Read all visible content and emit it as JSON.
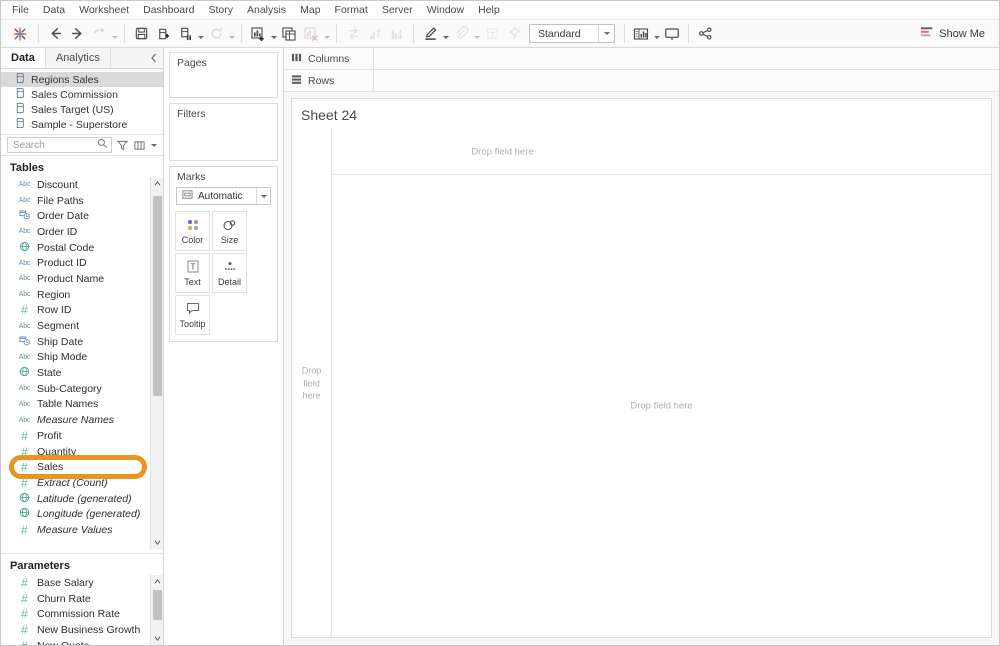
{
  "menubar": {
    "items": [
      "File",
      "Data",
      "Worksheet",
      "Dashboard",
      "Story",
      "Analysis",
      "Map",
      "Format",
      "Server",
      "Window",
      "Help"
    ]
  },
  "toolbar": {
    "logo_icon": "tableau-logo-icon",
    "buttons": [
      {
        "name": "back-button",
        "icon": "arrow-left-icon",
        "disabled": false
      },
      {
        "name": "forward-button",
        "icon": "arrow-right-icon",
        "disabled": false
      },
      {
        "name": "undo-redo-button",
        "icon": "undo-icon",
        "disabled": true
      },
      {
        "name": "save-button",
        "icon": "save-icon",
        "disabled": false
      },
      {
        "name": "new-data-source-button",
        "icon": "data-source-add-icon",
        "disabled": false
      },
      {
        "name": "pause-auto-updates-button",
        "icon": "pause-updates-icon",
        "disabled": false
      },
      {
        "name": "refresh-button",
        "icon": "refresh-icon",
        "disabled": true
      },
      {
        "name": "new-worksheet-button",
        "icon": "new-worksheet-icon",
        "disabled": false
      },
      {
        "name": "duplicate-sheet-button",
        "icon": "duplicate-sheet-icon",
        "disabled": false
      },
      {
        "name": "clear-sheet-button",
        "icon": "clear-sheet-icon",
        "disabled": true
      },
      {
        "name": "swap-rows-columns-button",
        "icon": "swap-axes-icon",
        "disabled": true
      },
      {
        "name": "sort-ascending-button",
        "icon": "sort-ascending-icon",
        "disabled": true
      },
      {
        "name": "sort-descending-button",
        "icon": "sort-descending-icon",
        "disabled": true
      },
      {
        "name": "highlight-button",
        "icon": "highlighter-icon",
        "disabled": false
      },
      {
        "name": "group-members-button",
        "icon": "paperclip-icon",
        "disabled": true
      },
      {
        "name": "show-mark-labels-button",
        "icon": "text-label-icon",
        "disabled": true
      },
      {
        "name": "fix-axes-button",
        "icon": "pin-icon",
        "disabled": true
      },
      {
        "name": "presentation-mode-button",
        "icon": "presentation-icon",
        "disabled": false
      },
      {
        "name": "share-button",
        "icon": "share-icon",
        "disabled": false
      }
    ],
    "fit": {
      "value": "Standard",
      "caret_icon": "chevron-down-icon"
    },
    "show_me": {
      "label": "Show Me",
      "icon": "show-me-icon"
    }
  },
  "data_pane": {
    "tabs": [
      {
        "label": "Data",
        "active": true
      },
      {
        "label": "Analytics",
        "active": false
      }
    ],
    "collapse_icon": "chevron-left-icon",
    "data_sources": [
      {
        "label": "Regions Sales",
        "icon": "database-icon",
        "selected": true
      },
      {
        "label": "Sales Commission",
        "icon": "database-icon",
        "selected": false
      },
      {
        "label": "Sales Target (US)",
        "icon": "database-icon",
        "selected": false
      },
      {
        "label": "Sample - Superstore",
        "icon": "database-icon",
        "selected": false
      }
    ],
    "search": {
      "placeholder": "Search",
      "search_icon": "search-icon",
      "filter_icon": "funnel-icon",
      "group_icon": "columns-icon",
      "caret_icon": "chevron-down-icon"
    },
    "tables": {
      "title": "Tables",
      "fields": [
        {
          "label": "Discount",
          "type": "abc",
          "italic": false
        },
        {
          "label": "File Paths",
          "type": "abc",
          "italic": false
        },
        {
          "label": "Order Date",
          "type": "date",
          "italic": false
        },
        {
          "label": "Order ID",
          "type": "abc",
          "italic": false
        },
        {
          "label": "Postal Code",
          "type": "geo",
          "italic": false
        },
        {
          "label": "Product ID",
          "type": "abc",
          "italic": false
        },
        {
          "label": "Product Name",
          "type": "abc",
          "italic": false
        },
        {
          "label": "Region",
          "type": "abc",
          "italic": false
        },
        {
          "label": "Row ID",
          "type": "num",
          "italic": false
        },
        {
          "label": "Segment",
          "type": "abc",
          "italic": false
        },
        {
          "label": "Ship Date",
          "type": "date",
          "italic": false
        },
        {
          "label": "Ship Mode",
          "type": "abc",
          "italic": false
        },
        {
          "label": "State",
          "type": "geo",
          "italic": false
        },
        {
          "label": "Sub-Category",
          "type": "abc",
          "italic": false
        },
        {
          "label": "Table Names",
          "type": "abc",
          "italic": false
        },
        {
          "label": "Measure Names",
          "type": "abc",
          "italic": true
        },
        {
          "label": "Profit",
          "type": "num",
          "italic": false
        },
        {
          "label": "Quantity",
          "type": "num",
          "italic": false
        },
        {
          "label": "Sales",
          "type": "num",
          "italic": false,
          "highlighted": true
        },
        {
          "label": "Extract (Count)",
          "type": "num",
          "italic": true
        },
        {
          "label": "Latitude (generated)",
          "type": "geo",
          "italic": true
        },
        {
          "label": "Longitude (generated)",
          "type": "geo",
          "italic": true
        },
        {
          "label": "Measure Values",
          "type": "num",
          "italic": true
        }
      ]
    },
    "parameters": {
      "title": "Parameters",
      "fields": [
        {
          "label": "Base Salary",
          "type": "num"
        },
        {
          "label": "Churn Rate",
          "type": "num"
        },
        {
          "label": "Commission Rate",
          "type": "num"
        },
        {
          "label": "New Business Growth",
          "type": "num"
        },
        {
          "label": "New Quota",
          "type": "num"
        }
      ]
    },
    "scroll_up_icon": "chevron-up-icon",
    "scroll_down_icon": "chevron-down-icon"
  },
  "cards": {
    "pages": {
      "title": "Pages"
    },
    "filters": {
      "title": "Filters"
    },
    "marks": {
      "title": "Marks",
      "mark_type": {
        "value": "Automatic",
        "icon": "automatic-mark-icon",
        "caret_icon": "chevron-down-icon"
      },
      "buttons": [
        {
          "label": "Color",
          "icon": "color-dots-icon"
        },
        {
          "label": "Size",
          "icon": "size-icon"
        },
        {
          "label": "Text",
          "icon": "text-icon"
        },
        {
          "label": "Detail",
          "icon": "detail-icon"
        },
        {
          "label": "Tooltip",
          "icon": "tooltip-icon"
        }
      ]
    }
  },
  "shelves": [
    {
      "label": "Columns",
      "icon": "columns-shelf-icon"
    },
    {
      "label": "Rows",
      "icon": "rows-shelf-icon"
    }
  ],
  "worksheet": {
    "title": "Sheet 24",
    "column_drop_label": "Drop field here",
    "row_drop_label": "Drop\nfield\nhere",
    "canvas_drop_label": "Drop field here"
  },
  "colors": {
    "highlight_ring": "#E8941E",
    "dimension_blue": "#6f8fa8",
    "measure_green": "#5fb9a0",
    "selection_gray": "#d9d9d9"
  }
}
